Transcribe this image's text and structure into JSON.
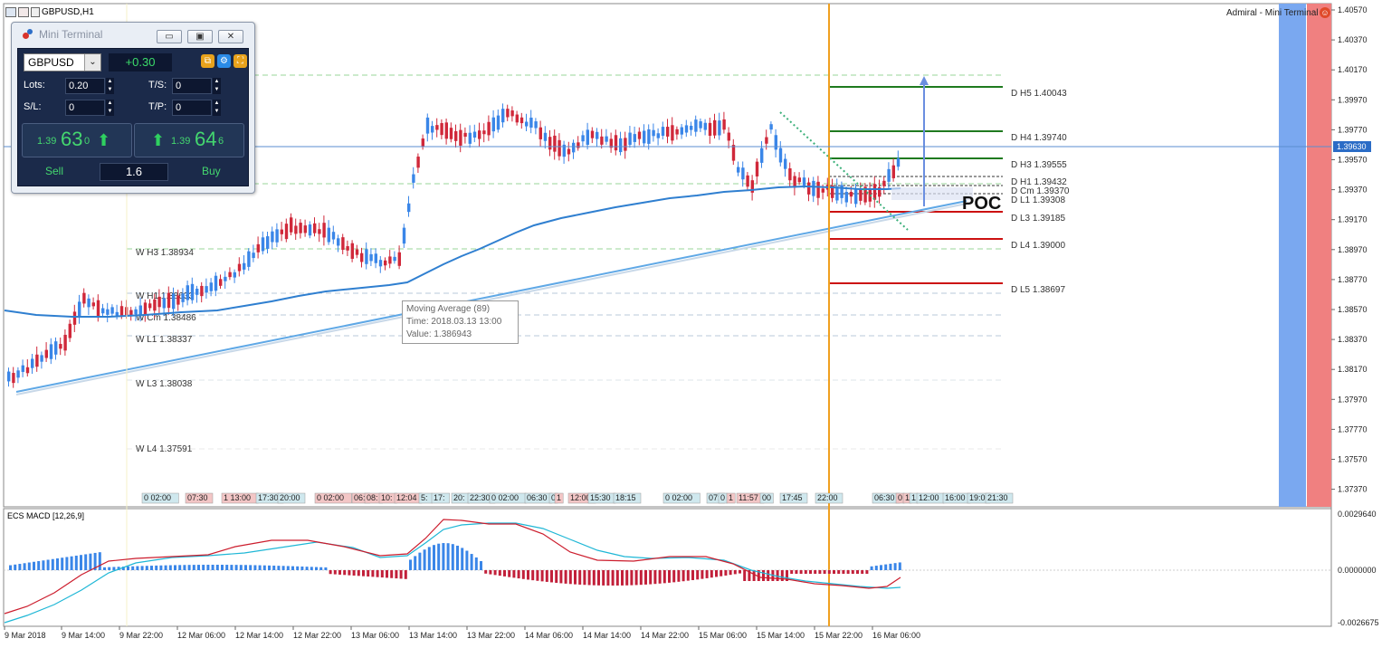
{
  "window_title": "GBPUSD,H1",
  "broker_label": "Admiral - Mini Terminal",
  "price_axis": [
    "1.40570",
    "1.40370",
    "1.40170",
    "1.39970",
    "1.39770",
    "1.39570",
    "1.39370",
    "1.39170",
    "1.38970",
    "1.38770",
    "1.38570",
    "1.38370",
    "1.38170",
    "1.37970",
    "1.37770",
    "1.37570",
    "1.37370"
  ],
  "current_price": "1.39630",
  "macd_axis": [
    "0.0029640",
    "0.0000000",
    "-0.0026675"
  ],
  "macd_label": "ECS MACD [12,26,9]",
  "time_axis": [
    "9 Mar 2018",
    "9 Mar 14:00",
    "9 Mar 22:00",
    "12 Mar 06:00",
    "12 Mar 14:00",
    "12 Mar 22:00",
    "13 Mar 06:00",
    "13 Mar 14:00",
    "13 Mar 22:00",
    "14 Mar 06:00",
    "14 Mar 14:00",
    "14 Mar 22:00",
    "15 Mar 06:00",
    "15 Mar 14:00",
    "15 Mar 22:00",
    "16 Mar 06:00"
  ],
  "daily_levels": [
    {
      "label": "D  H5 1.40043",
      "color": "#1f7a1f"
    },
    {
      "label": "D  H4 1.39740",
      "color": "#1f7a1f"
    },
    {
      "label": "D  H3 1.39555",
      "color": "#1f7a1f"
    },
    {
      "label": "D  H1 1.39432",
      "color": "#333333"
    },
    {
      "label": "D  Cm  1.39370",
      "color": "#333333"
    },
    {
      "label": "D  L1 1.39308",
      "color": "#333333"
    },
    {
      "label": "D  L3 1.39185",
      "color": "#cc1111"
    },
    {
      "label": "D  L4 1.39000",
      "color": "#cc1111"
    },
    {
      "label": "D  L5 1.38697",
      "color": "#cc1111"
    }
  ],
  "weekly_levels": [
    "W  H3 1.38934",
    "W  H1 1.38633",
    "W  Cm 1.38486",
    "W  L1 1.38337",
    "W  L3 1.38038",
    "W  L4 1.37591"
  ],
  "poc_label": "POC",
  "session_labels": [
    "0 02:00",
    "07:30",
    "1 13:00",
    "17:30",
    "20:00",
    "0 02:00",
    "06:",
    "08:",
    "10:",
    "12:04",
    "5:",
    "17:",
    "20:",
    "22:30",
    "0 02:00",
    "06:30",
    "0",
    "1",
    "12:00",
    "15:30",
    "18:15",
    "0 02:00",
    "07:",
    "0",
    "1",
    "11:57",
    "00",
    "17:45",
    "22:00",
    "06:30",
    "0",
    "1",
    "1",
    "12:00",
    "16:00",
    "19:0",
    "21:30"
  ],
  "moving_average_tooltip": {
    "line1": "Moving Average (89)",
    "line2": "Time: 2018.03.13 13:00",
    "line3": "Value: 1.386943"
  },
  "mini_terminal": {
    "title": "Mini Terminal",
    "symbol": "GBPUSD",
    "spread": "+0.30",
    "lots_label": "Lots:",
    "lots_value": "0.20",
    "ts_label": "T/S:",
    "ts_value": "0",
    "sl_label": "S/L:",
    "sl_value": "0",
    "tp_label": "T/P:",
    "tp_value": "0",
    "sell_prefix": "1.39",
    "sell_big": "63",
    "sell_small": "0",
    "buy_prefix": "1.39",
    "buy_big": "64",
    "buy_small": "6",
    "sell_label": "Sell",
    "buy_label": "Buy",
    "volume": "1.6"
  },
  "colors": {
    "bull": "#3a86e8",
    "bear": "#d0283a",
    "ma_line": "#2f7fd0",
    "trend_line": "#5fa8e6",
    "orange_marker": "#f0a020",
    "macd_signal": "#1fb7d6",
    "macd_main": "#cc1d2d",
    "heat_blue": "#7aa8f0",
    "heat_red": "#f08080"
  }
}
